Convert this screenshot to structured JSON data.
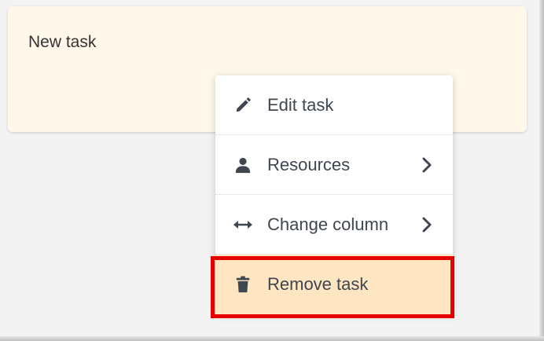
{
  "task_card": {
    "title": "New task"
  },
  "context_menu": {
    "items": [
      {
        "label": "Edit task",
        "icon": "pencil-icon",
        "has_submenu": false
      },
      {
        "label": "Resources",
        "icon": "user-icon",
        "has_submenu": true
      },
      {
        "label": "Change column",
        "icon": "arrows-horizontal-icon",
        "has_submenu": true
      },
      {
        "label": "Remove task",
        "icon": "trash-icon",
        "has_submenu": false,
        "highlighted": true
      }
    ]
  },
  "colors": {
    "background": "#f3f3f3",
    "card_background": "#fff8ea",
    "menu_background": "#ffffff",
    "highlight_background": "#ffe6c2",
    "highlight_border": "#e60000",
    "text": "#3f4650"
  }
}
